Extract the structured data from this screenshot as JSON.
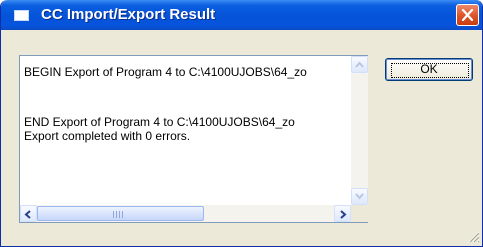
{
  "window": {
    "title": "CC Import/Export Result"
  },
  "log": {
    "lines": [
      "BEGIN Export of Program 4 to C:\\4100UJOBS\\64_zo",
      "",
      "",
      "END Export of Program 4 to C:\\4100UJOBS\\64_zo",
      "Export completed with 0 errors."
    ]
  },
  "buttons": {
    "ok_label": "OK"
  },
  "colors": {
    "titlebar": "#0553d8",
    "close_button": "#e0562a",
    "dialog_face": "#ece9d8",
    "text_border": "#7f9db9"
  },
  "icons": [
    "window-icon",
    "close-icon",
    "scroll-up-icon",
    "scroll-down-icon",
    "scroll-left-icon",
    "scroll-right-icon",
    "resize-grip-icon"
  ]
}
